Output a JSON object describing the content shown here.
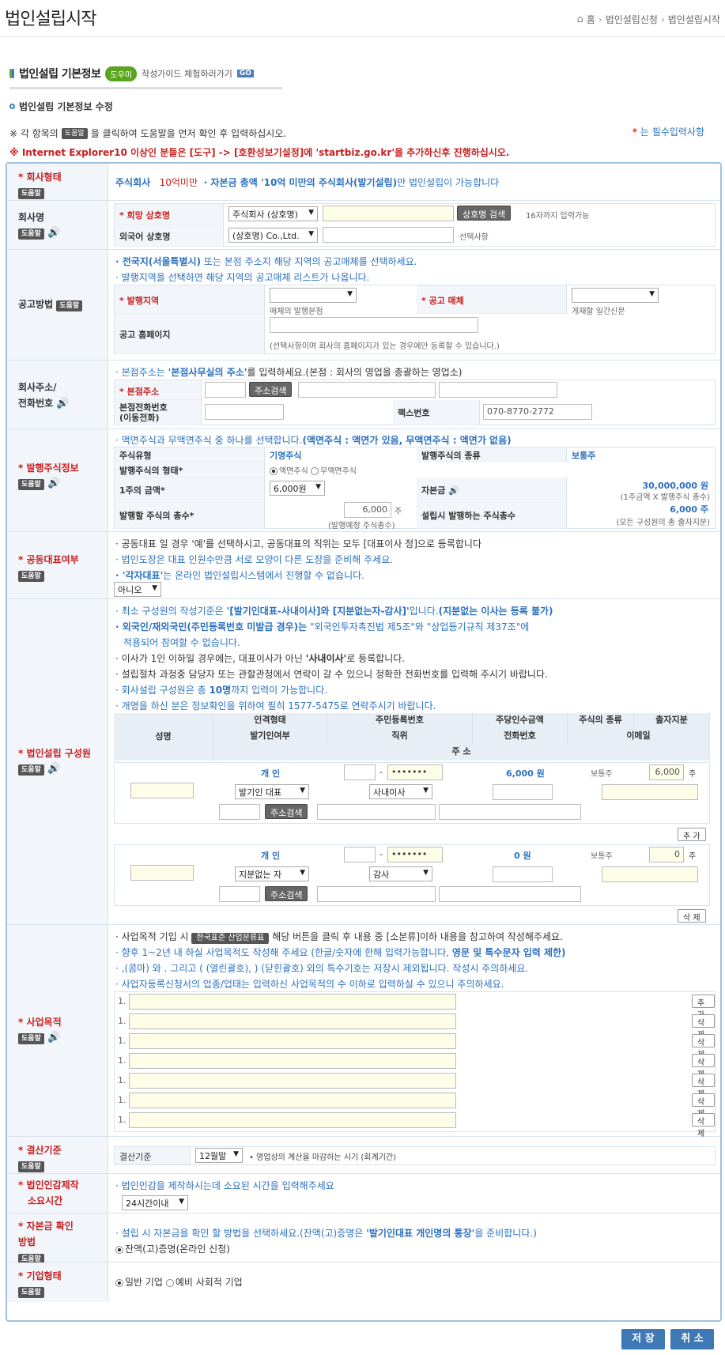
{
  "page": {
    "title": "법인설립시작",
    "breadcrumb": [
      "홈",
      "법인설립신청",
      "법인설립시작"
    ]
  },
  "section": {
    "title": "법인설립 기본정보",
    "pill": "도우미",
    "guide": "작성가이드 체험하러가기",
    "go": "GO",
    "sub": "법인설립 기본정보 수정"
  },
  "notes": {
    "n1a": "※ 각 항목의",
    "help": "도움말",
    "n1b": "을 클릭하여 도움말을 먼저 확인 후 입력하십시오.",
    "req_mark": "*",
    "req_text": "는 필수입력사항",
    "n2": "※ Internet Explorer10 이상인 분들은 [도구] -> [호환성보기설정]에 'startbiz.go.kr'을 추가하신후 진행하십시오."
  },
  "company_type": {
    "label": "* 회사형태",
    "value": "주식회사",
    "sub": "10억미만",
    "desc1": "· 자본금 총액 '10억 미만의 주식회사(발기설립)",
    "desc2": "만 법인설립이 가능합니다"
  },
  "company_name": {
    "label": "회사명",
    "hope_label": "* 희망 상호명",
    "hope_select": "주식회사 (상호명)",
    "check_btn": "상호명 검색",
    "limit": "16자까지 입력가능",
    "foreign_label": "외국어 상호명",
    "foreign_select": "(상호명) Co.,Ltd.",
    "optional": "선택사항"
  },
  "notice": {
    "label": "공고방법",
    "l1a": "· 전국지(서울특별시)",
    "l1b": "또는 본점 주소지 해당 지역의 공고매체를 선택하세요.",
    "l2": "· 발행지역을 선택하면 해당 지역의 공고매체 리스트가 나옵니다.",
    "region_label": "* 발행지역",
    "region_sub": "매체의 발행본점",
    "media_label": "* 공고 매체",
    "media_sub": "게재할 일간신문",
    "homepage_label": "공고 홈페이지",
    "homepage_note": "(선택사항이며 회사의 홈페이지가 있는 경우에만 등록할 수 있습니다.)"
  },
  "address": {
    "label1": "회사주소/",
    "label2": "전화번호",
    "l1a": "· 본점주소는",
    "l1b": "'본점사무실의 주소'",
    "l1c": "를 입력하세요.(본점 : 회사의 영업을 총괄하는 영업소)",
    "addr_label": "* 본점주소",
    "addr_btn": "주소검색",
    "phone_label1": "본점전화번호",
    "phone_label2": "(이동전화)",
    "fax_label": "팩스번호",
    "fax_value": "070-8770-2772"
  },
  "stock": {
    "label": "* 발행주식정보",
    "l1a": "· 액면주식과 무액면주식 중 하나를 선택합니다.",
    "l1b": "(액면주식 : 액면가 있음, 무액면주식 : 액면가 없음)",
    "type_h": "주식유형",
    "type_v": "기명주식",
    "kind_h": "발행주식의 종류",
    "kind_v": "보통주",
    "form_h": "발행주식의 형태*",
    "form_o1": "액면주식",
    "form_o2": "무액면주식",
    "par_h": "1주의 금액*",
    "par_v": "6,000원",
    "capital_h": "자본금",
    "capital_v": "30,000,000 원",
    "capital_note": "(1주금액 X 발행주식 총수)",
    "total_h": "발행할 주식의 총수*",
    "total_v": "6,000",
    "total_unit": "주",
    "total_note": "(발행예정 주식총수)",
    "estab_h": "설립시 발행하는 주식총수",
    "estab_v": "6,000 주",
    "estab_note": "(모든 구성원의 총 출자지분)"
  },
  "corep": {
    "label": "* 공동대표여부",
    "l1": "· 공동대표 일 경우 '예'를 선택하시고, 공동대표의 직위는 모두 [대표이사 정]으로 등록합니다",
    "l2": "· 법인도장은 대표 인원수만큼 서로 모양이 다른 도장을 준비해 주세요.",
    "l3a": "· '각자대표'",
    "l3b": "는 온라인 법인설립시스템에서 진행할 수 없습니다.",
    "select": "아니오"
  },
  "members": {
    "label": "* 법인설립 구성원",
    "l1a": "· 최소 구성원의 작성기준은",
    "l1b": "'[발기인대표-사내이사]와 [지분없는자-감사]'",
    "l1c": "입니다.",
    "l1d": "(지분없는 이사는 등록 불가)",
    "l2a": "· 외국인/재외국민(주민등록번호 미발급 경우)는",
    "l2b": "\"외국인투자촉진법 제5조\"와 \"상업등기규칙 제37조\"에",
    "l2c": "적용되어 참여할 수 없습니다.",
    "l3a": "· 이사가 1인 이하일 경우에는, 대표이사가 아닌",
    "l3b": "'사내이사'",
    "l3c": "로 등록합니다.",
    "l4": "· 설립절차 과정중 담당자 또는 관할관청에서 연락이 갈 수 있으니 정확한 전화번호를 입력해 주시기 바랍니다.",
    "l5a": "· 회사설립 구성원은 총",
    "l5b": "10명",
    "l5c": "까지 입력이 가능합니다.",
    "l6": "· 개명을 하신 분은 정보확인을 위하여 필히 1577-5475로 연락주시기 바랍니다.",
    "h_name": "성명",
    "h_form": "인격형태",
    "h_rrn": "주민등록번호",
    "h_amount": "주당인수금액",
    "h_kind": "주식의 종류",
    "h_share": "출자지분",
    "h_founder": "발기인여부",
    "h_pos": "직위",
    "h_tel": "전화번호",
    "h_email": "이메일",
    "h_addr": "주 소",
    "m1_form": "개 인",
    "m1_rrn": "•••••••",
    "m1_amount": "6,000 원",
    "m1_kind": "보통주",
    "m1_share": "6,000",
    "m1_founder": "발기인 대표",
    "m1_pos": "사내이사",
    "m2_form": "개 인",
    "m2_rrn": "•••••••",
    "m2_amount": "0 원",
    "m2_kind": "보통주",
    "m2_share": "0",
    "m2_founder": "지분없는 자",
    "m2_pos": "감사",
    "unit": "주",
    "addr_btn": "주소검색",
    "add_btn": "추 가",
    "del_btn": "삭 제"
  },
  "purpose": {
    "label": "* 사업목적",
    "l1a": "· 사업목적 기입 시",
    "l1btn": "한국표준 산업분류표",
    "l1b": "해당 버튼을 클릭 후 내용 중 [소분류]이하 내용을 참고하여 작성해주세요.",
    "l2a": "· 향후 1~2년 내 하실 사업목적도 작성해 주세요 (한글/숫자에 한해 입력가능합니다,",
    "l2b": "영문 및 특수문자 입력 제한)",
    "l3": "· ,(콤마) 와 . 그리고 ( (열린괄호), ) (닫힌괄호) 외의 특수기호는 저장시 제외됩니다. 작성시 주의하세요.",
    "l4": "· 사업자등록신청서의 업종/업태는 입력하신 사업목적의 수 이하로 입력하실 수 있으니 주의하세요.",
    "num": "1.",
    "add_btn": "추 가",
    "del_btn": "삭 제"
  },
  "fiscal": {
    "label": "* 결산기준",
    "inner": "결산기준",
    "select": "12월말",
    "note": "• 영업상의 계산을 마감하는 시기 (회계기간)"
  },
  "seal": {
    "label1": "* 법인인감제작",
    "label2": "소요시간",
    "note": "· 법인인감을 제작하시는데 소요된 시간을 입력해주세요",
    "select": "24시간이내"
  },
  "capital": {
    "label1": "* 자본금 확인",
    "label2": "방법",
    "l1a": "· 설립 시 자본금을 확인 할 방법을 선택하세요.(잔액(고)증명은",
    "l1b": "'발기인대표 개인명의 통장'",
    "l1c": "을 준비합니다.)",
    "opt": "잔액(고)증명(온라인 신청)"
  },
  "biz": {
    "label": "* 기업형태",
    "o1": "일반 기업",
    "o2": "예비 사회적 기업"
  },
  "actions": {
    "save": "저 장",
    "cancel": "취 소"
  }
}
